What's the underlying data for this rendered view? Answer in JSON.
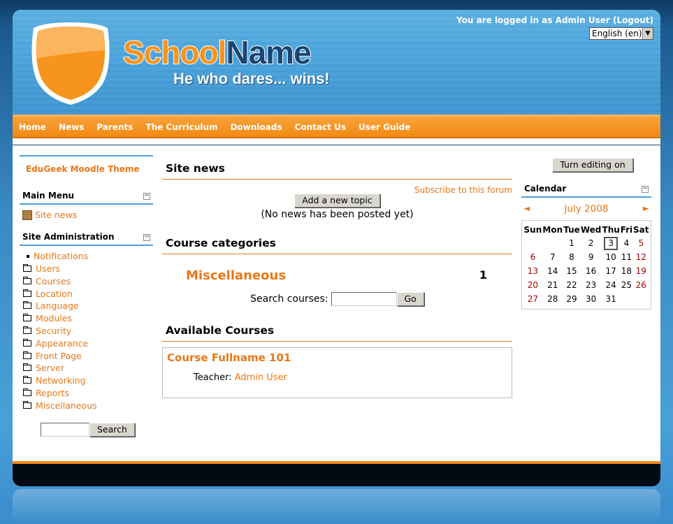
{
  "header": {
    "school_word1": "School",
    "school_word2": "Name",
    "tagline": "He who dares... wins!",
    "login_prefix": "You are logged in as ",
    "login_user": "Admin User",
    "logout": "(Logout)",
    "language": "English (en)"
  },
  "nav": [
    "Home",
    "News",
    "Parents",
    "The Curriculum",
    "Downloads",
    "Contact Us",
    "User Guide"
  ],
  "left": {
    "theme_title": "EduGeek Moodle Theme",
    "main_menu_title": "Main Menu",
    "main_menu_items": [
      "Site news"
    ],
    "admin_title": "Site Administration",
    "admin_first": "Notifications",
    "admin_items": [
      "Users",
      "Courses",
      "Location",
      "Language",
      "Modules",
      "Security",
      "Appearance",
      "Front Page",
      "Server",
      "Networking",
      "Reports",
      "Miscellaneous"
    ],
    "search_button": "Search"
  },
  "middle": {
    "site_news_title": "Site news",
    "subscribe": "Subscribe to this forum",
    "add_topic": "Add a new topic",
    "no_news": "(No news has been posted yet)",
    "categories_title": "Course categories",
    "category_name": "Miscellaneous",
    "category_count": "1",
    "search_courses_label": "Search courses:",
    "go_button": "Go",
    "available_title": "Available Courses",
    "course_name": "Course Fullname 101",
    "teacher_label": "Teacher:",
    "teacher_name": "Admin User"
  },
  "right": {
    "edit_button": "Turn editing on",
    "calendar_title": "Calendar",
    "prev": "◄",
    "next": "►",
    "month": "July 2008",
    "weekdays": [
      "Sun",
      "Mon",
      "Tue",
      "Wed",
      "Thu",
      "Fri",
      "Sat"
    ],
    "weeks": [
      [
        "",
        "",
        "1",
        "2",
        "3",
        "4",
        "5"
      ],
      [
        "6",
        "7",
        "8",
        "9",
        "10",
        "11",
        "12"
      ],
      [
        "13",
        "14",
        "15",
        "16",
        "17",
        "18",
        "19"
      ],
      [
        "20",
        "21",
        "22",
        "23",
        "24",
        "25",
        "26"
      ],
      [
        "27",
        "28",
        "29",
        "30",
        "31",
        "",
        ""
      ]
    ],
    "today": "3"
  },
  "colors": {
    "accent": "#e87817",
    "blue": "#4aa0d8",
    "navy": "#1a4672"
  }
}
